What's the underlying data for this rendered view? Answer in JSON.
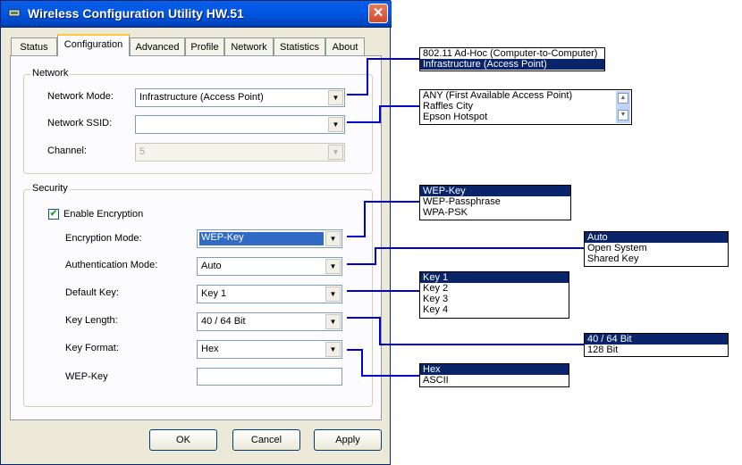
{
  "window": {
    "title": "Wireless Configuration Utility HW.51",
    "close_symbol": "✕"
  },
  "tabs": [
    "Status",
    "Configuration",
    "Advanced",
    "Profile",
    "Network",
    "Statistics",
    "About"
  ],
  "active_tab": "Configuration",
  "network": {
    "legend": "Network",
    "mode_label": "Network Mode:",
    "mode_value": "Infrastructure (Access Point)",
    "ssid_label": "Network SSID:",
    "ssid_value": "",
    "channel_label": "Channel:",
    "channel_value": "5"
  },
  "security": {
    "legend": "Security",
    "enable_label": "Enable Encryption",
    "enable_checked": true,
    "enc_mode_label": "Encryption Mode:",
    "enc_mode_value": "WEP-Key",
    "auth_mode_label": "Authentication Mode:",
    "auth_mode_value": "Auto",
    "default_key_label": "Default Key:",
    "default_key_value": "Key 1",
    "key_length_label": "Key Length:",
    "key_length_value": "40 / 64 Bit",
    "key_format_label": "Key Format:",
    "key_format_value": "Hex",
    "wep_key_label": "WEP-Key",
    "wep_key_value": ""
  },
  "buttons": {
    "ok": "OK",
    "cancel": "Cancel",
    "apply": "Apply"
  },
  "callouts": {
    "network_mode_options": [
      "802.11 Ad-Hoc (Computer-to-Computer)",
      "Infrastructure (Access Point)"
    ],
    "ssid_options": [
      "ANY (First Available Access Point)",
      "Raffles City",
      "Epson Hotspot"
    ],
    "encryption_mode_options": [
      "WEP-Key",
      "WEP-Passphrase",
      "WPA-PSK"
    ],
    "auth_mode_options": [
      "Auto",
      "Open System",
      "Shared Key"
    ],
    "default_key_options": [
      "Key 1",
      "Key 2",
      "Key 3",
      "Key 4"
    ],
    "key_length_options": [
      "40 / 64 Bit",
      "128 Bit"
    ],
    "key_format_options": [
      "Hex",
      "ASCII"
    ]
  },
  "colors": {
    "titlebar": "#0058e6",
    "selection": "#0a246a",
    "connector": "#0000cc",
    "close": "#d34a2c"
  }
}
